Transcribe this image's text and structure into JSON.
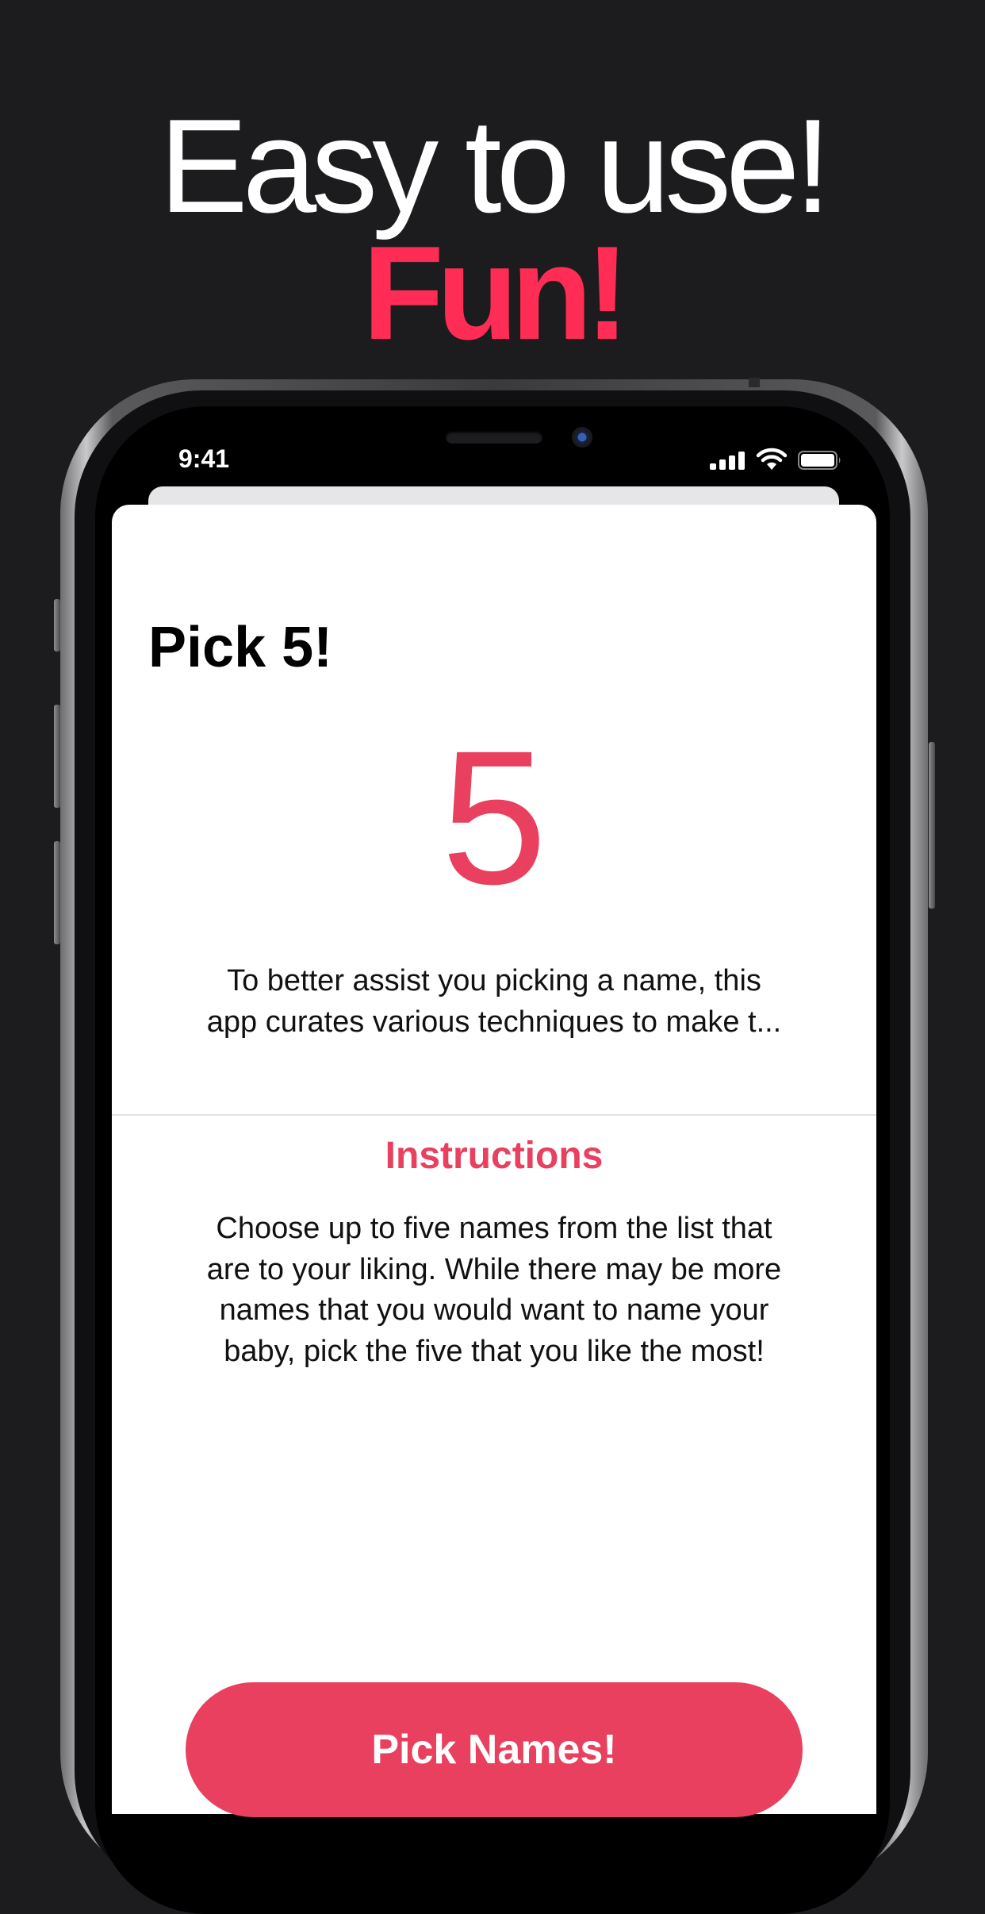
{
  "promo": {
    "headline_line1": "Easy to use!",
    "headline_line2": "Fun!",
    "accent_color": "#ff2d55"
  },
  "status_bar": {
    "time": "9:41",
    "icons": [
      "signal-icon",
      "wifi-icon",
      "battery-icon"
    ]
  },
  "screen": {
    "title": "Pick 5!",
    "count": "5",
    "description_lines": [
      "To better assist you picking a name, this",
      "app curates various techniques to make t..."
    ],
    "instructions_heading": "Instructions",
    "instructions_lines": [
      "Choose up to five names from the list that",
      "are to your liking. While there may be more",
      "names that you would want to name your",
      "baby, pick the five that you like the most!"
    ],
    "primary_button": "Pick Names!",
    "accent_color": "#e8405e"
  }
}
